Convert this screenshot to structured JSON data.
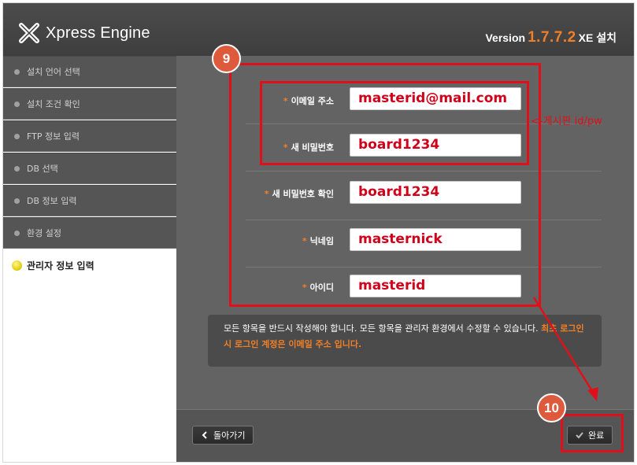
{
  "header": {
    "app_name": "Xpress Engine",
    "version_prefix": "Version",
    "version_number": "1.7.7.2",
    "version_suffix": "XE 설치"
  },
  "sidebar": {
    "items": [
      {
        "label": "설치 언어 선택"
      },
      {
        "label": "설치 조건 확인"
      },
      {
        "label": "FTP 정보 입력"
      },
      {
        "label": "DB 선택"
      },
      {
        "label": "DB 정보 입력"
      },
      {
        "label": "환경 설정"
      },
      {
        "label": "관리자 정보 입력"
      }
    ]
  },
  "form": {
    "required_mark": "*",
    "fields": [
      {
        "label": "이메일 주소",
        "value": "masterid@mail.com"
      },
      {
        "label": "새 비밀번호",
        "value": "board1234"
      },
      {
        "label": "새 비밀번호 확인",
        "value": "board1234"
      },
      {
        "label": "닉네임",
        "value": "masternick"
      },
      {
        "label": "아이디",
        "value": "masterid"
      }
    ]
  },
  "notice": {
    "text": "모든 항목을 반드시 작성해야 합니다. 모든 항목을 관리자 환경에서 수정할 수 있습니다.",
    "highlight": "최초 로그인시 로그인 계정은 이메일 주소 입니다."
  },
  "footer": {
    "back_label": "돌아가기",
    "done_label": "완료"
  },
  "annotations": {
    "badge_1": "9",
    "badge_2": "10",
    "side_note": "<-게시판 id/pw"
  },
  "colors": {
    "accent": "#f07f28",
    "annotation": "#e0101a",
    "panel": "#636363"
  }
}
